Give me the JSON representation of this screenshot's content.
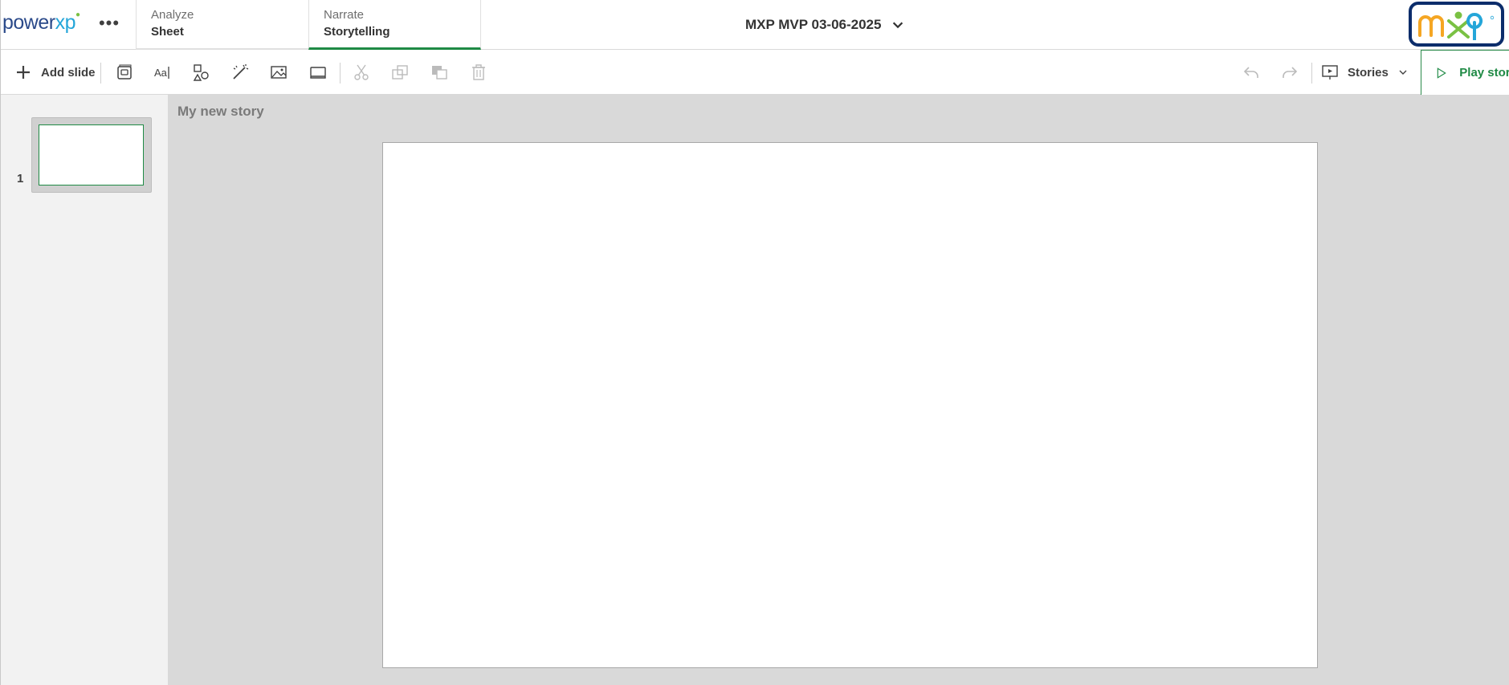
{
  "brand": {
    "logo_text_main": "power",
    "logo_text_accent": "xp"
  },
  "nav": {
    "tabs": [
      {
        "top": "Analyze",
        "bottom": "Sheet"
      },
      {
        "top": "Narrate",
        "bottom": "Storytelling"
      }
    ]
  },
  "app": {
    "title": "MXP MVP 03-06-2025"
  },
  "toolbar": {
    "add_slide_label": "Add slide",
    "stories_label": "Stories",
    "play_label": "Play story"
  },
  "slides": {
    "items": [
      {
        "number": "1"
      }
    ]
  },
  "story": {
    "title": "My new story"
  },
  "colors": {
    "accent_green": "#1f8a45",
    "brand_navy": "#0c2d6b",
    "brand_blue": "#25a6d9",
    "brand_orange": "#f5a623"
  }
}
